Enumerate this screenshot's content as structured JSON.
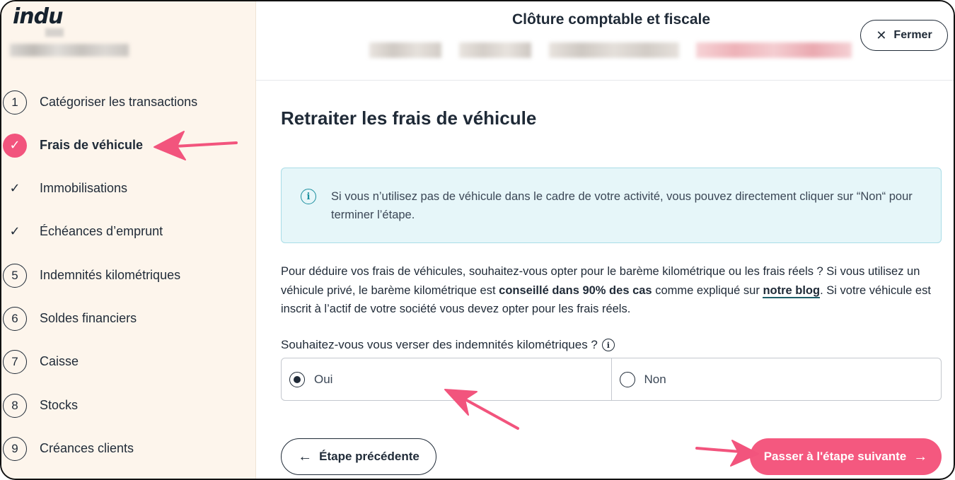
{
  "app": {
    "logo_text": "indu"
  },
  "header": {
    "title": "Clôture comptable et fiscale",
    "close_label": "Fermer",
    "close_icon": "close-icon"
  },
  "sidebar": {
    "steps": [
      {
        "marker": "1",
        "label": "Catégoriser les transactions",
        "state": "todo"
      },
      {
        "marker": "✓",
        "label": "Frais de véhicule",
        "state": "active"
      },
      {
        "marker": "✓",
        "label": "Immobilisations",
        "state": "done"
      },
      {
        "marker": "✓",
        "label": "Échéances d’emprunt",
        "state": "done"
      },
      {
        "marker": "5",
        "label": "Indemnités kilométriques",
        "state": "todo"
      },
      {
        "marker": "6",
        "label": "Soldes financiers",
        "state": "todo"
      },
      {
        "marker": "7",
        "label": "Caisse",
        "state": "todo"
      },
      {
        "marker": "8",
        "label": "Stocks",
        "state": "todo"
      },
      {
        "marker": "9",
        "label": "Créances clients",
        "state": "todo"
      }
    ]
  },
  "main": {
    "title": "Retraiter les frais de véhicule",
    "info": {
      "icon": "info-icon",
      "text": "Si vous n’utilisez pas de véhicule dans le cadre de votre activité, vous pouvez directement cliquer sur “Non“ pour terminer l’étape."
    },
    "paragraph": {
      "part1": "Pour déduire vos frais de véhicules, souhaitez-vous opter pour le barème kilométrique ou les frais réels ? Si vous utilisez un véhicule privé, le barème kilométrique est ",
      "bold": "conseillé dans 90% des cas",
      "part2": " comme expliqué sur ",
      "link": "notre blog",
      "part3": ". Si votre véhicule est inscrit à l’actif de votre société vous devez opter pour les frais réels."
    },
    "question": "Souhaitez-vous vous verser des indemnités kilométriques ?",
    "options": [
      {
        "label": "Oui",
        "selected": true
      },
      {
        "label": "Non",
        "selected": false
      }
    ],
    "prev_label": "Étape précédente",
    "next_label": "Passer à l'étape suivante"
  },
  "colors": {
    "accent": "#f4587f",
    "sidebar_bg": "#fdf5ec",
    "info_bg": "#e6f6f9",
    "annotation": "#f2547d"
  }
}
